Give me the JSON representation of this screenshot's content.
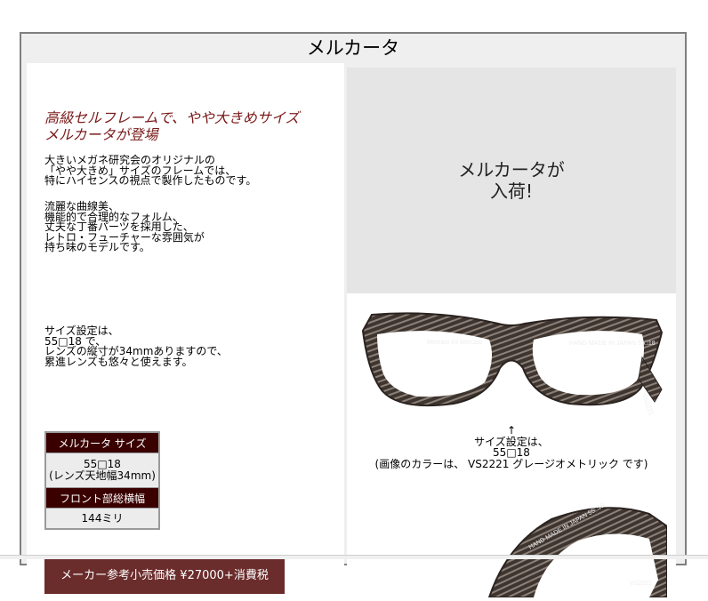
{
  "page": {
    "title": "メルカータ"
  },
  "intro": {
    "tagline_lines": [
      "高級セルフレームで、やや大きめサイズ",
      "メルカータが登場"
    ],
    "paragraph1": [
      "大きいメガネ研究会のオリジナルの",
      "「やや大きめ」サイズのフレームでは、",
      "特にハイセンスの視点で製作したものです。"
    ],
    "paragraph2": [
      "流麗な曲線美、",
      "機能的で合理的なフォルム、",
      "丈夫な丁番パーツを採用した、",
      "レトロ・フューチャーな雰囲気が",
      "持ち味のモデルです。"
    ],
    "paragraph3": [
      "サイズ設定は、",
      "55□18 で、",
      "レンズの縦寸が34mmありますので、",
      "累進レンズも悠々と使えます。"
    ]
  },
  "size_table": {
    "header1": "メルカータ サイズ",
    "value1_line1": "55□18",
    "value1_line2": "(レンズ天地幅34mm)",
    "header2": "フロント部総横幅",
    "value2": "144ミリ"
  },
  "price": {
    "label": "メーカー参考小売価格 ¥27000+消費税"
  },
  "announcement": {
    "line1": "メルカータが",
    "line2": "入荷!"
  },
  "photo1": {
    "frame_text_left": "Mercato e3   Mercato",
    "frame_text_right": "HAND MADE IN JAPAN 55□18",
    "temple_text": "VS2221"
  },
  "caption": {
    "arrow": "↑",
    "line1": "サイズ設定は、",
    "line2": "55□18",
    "line3": "(画像のカラーは、 VS2221 グレージオメトリック です)"
  },
  "photo2": {
    "frame_text_right": "HAND MADE IN JAPAN 55□18",
    "temple_text": "VS2221"
  },
  "colors": {
    "frame_border": "#7f7f7f",
    "tagline": "#7b1a1a",
    "table_header_bg": "#3a0000",
    "price_bg": "#6b2c2c",
    "announcement_bg": "#e5e5e5"
  }
}
